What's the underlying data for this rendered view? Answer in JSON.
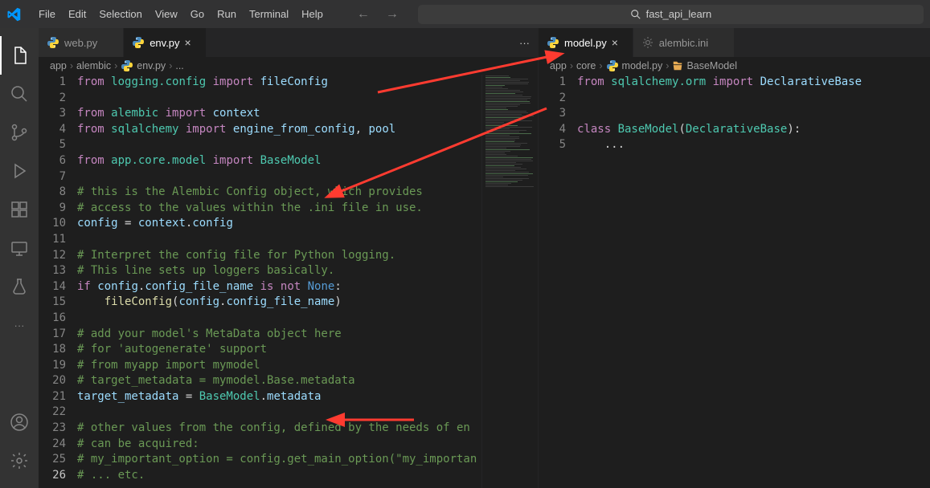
{
  "titlebar": {
    "menus": [
      "File",
      "Edit",
      "Selection",
      "View",
      "Go",
      "Run",
      "Terminal",
      "Help"
    ],
    "search": "fast_api_learn"
  },
  "left": {
    "tabs": [
      {
        "name": "web.py",
        "active": false
      },
      {
        "name": "env.py",
        "active": true
      }
    ],
    "breadcrumb": [
      "app",
      "alembic",
      "env.py",
      "..."
    ],
    "code": [
      {
        "n": 1,
        "t": [
          [
            "from ",
            "kw"
          ],
          [
            "logging.config ",
            "mod"
          ],
          [
            "import ",
            "kw"
          ],
          [
            "fileConfig",
            "var"
          ]
        ]
      },
      {
        "n": 2,
        "t": []
      },
      {
        "n": 3,
        "t": [
          [
            "from ",
            "kw"
          ],
          [
            "alembic ",
            "mod"
          ],
          [
            "import ",
            "kw"
          ],
          [
            "context",
            "var"
          ]
        ]
      },
      {
        "n": 4,
        "t": [
          [
            "from ",
            "kw"
          ],
          [
            "sqlalchemy ",
            "mod"
          ],
          [
            "import ",
            "kw"
          ],
          [
            "engine_from_config",
            "var"
          ],
          [
            ", ",
            "op"
          ],
          [
            "pool",
            "var"
          ]
        ]
      },
      {
        "n": 5,
        "t": []
      },
      {
        "n": 6,
        "t": [
          [
            "from ",
            "kw"
          ],
          [
            "app.core.model ",
            "mod"
          ],
          [
            "import ",
            "kw"
          ],
          [
            "BaseModel",
            "cls"
          ]
        ]
      },
      {
        "n": 7,
        "t": []
      },
      {
        "n": 8,
        "t": [
          [
            "# this is the Alembic Config object, which provides",
            "cmt"
          ]
        ]
      },
      {
        "n": 9,
        "t": [
          [
            "# access to the values within the .ini file in use.",
            "cmt"
          ]
        ]
      },
      {
        "n": 10,
        "t": [
          [
            "config ",
            "var"
          ],
          [
            "= ",
            "op"
          ],
          [
            "context",
            "var"
          ],
          [
            ".",
            "op"
          ],
          [
            "config",
            "var"
          ]
        ]
      },
      {
        "n": 11,
        "t": []
      },
      {
        "n": 12,
        "t": [
          [
            "# Interpret the config file for Python logging.",
            "cmt"
          ]
        ]
      },
      {
        "n": 13,
        "t": [
          [
            "# This line sets up loggers basically.",
            "cmt"
          ]
        ]
      },
      {
        "n": 14,
        "t": [
          [
            "if ",
            "kw"
          ],
          [
            "config",
            "var"
          ],
          [
            ".",
            "op"
          ],
          [
            "config_file_name ",
            "var"
          ],
          [
            "is not ",
            "kw"
          ],
          [
            "None",
            "none"
          ],
          [
            ":",
            ""
          ]
        ]
      },
      {
        "n": 15,
        "t": [
          [
            "    ",
            ""
          ],
          [
            "fileConfig",
            "fn"
          ],
          [
            "(",
            "op"
          ],
          [
            "config",
            "var"
          ],
          [
            ".",
            "op"
          ],
          [
            "config_file_name",
            "var"
          ],
          [
            ")",
            "op"
          ]
        ]
      },
      {
        "n": 16,
        "t": []
      },
      {
        "n": 17,
        "t": [
          [
            "# add your model's MetaData object here",
            "cmt"
          ]
        ]
      },
      {
        "n": 18,
        "t": [
          [
            "# for 'autogenerate' support",
            "cmt"
          ]
        ]
      },
      {
        "n": 19,
        "t": [
          [
            "# from myapp import mymodel",
            "cmt"
          ]
        ]
      },
      {
        "n": 20,
        "t": [
          [
            "# target_metadata = mymodel.Base.metadata",
            "cmt"
          ]
        ]
      },
      {
        "n": 21,
        "t": [
          [
            "target_metadata ",
            "var"
          ],
          [
            "= ",
            "op"
          ],
          [
            "BaseModel",
            "cls"
          ],
          [
            ".",
            "op"
          ],
          [
            "metadata",
            "var"
          ]
        ]
      },
      {
        "n": 22,
        "t": []
      },
      {
        "n": 23,
        "t": [
          [
            "# other values from the config, defined by the needs of en",
            "cmt"
          ]
        ]
      },
      {
        "n": 24,
        "t": [
          [
            "# can be acquired:",
            "cmt"
          ]
        ]
      },
      {
        "n": 25,
        "t": [
          [
            "# my_important_option = config.get_main_option(\"my_importan",
            "cmt"
          ]
        ]
      },
      {
        "n": 26,
        "t": [
          [
            "# ... etc.",
            "cmt"
          ]
        ],
        "current": true
      }
    ]
  },
  "right": {
    "tabs": [
      {
        "name": "model.py",
        "active": true
      },
      {
        "name": "alembic.ini",
        "active": false,
        "gear": true
      }
    ],
    "breadcrumb": [
      "app",
      "core",
      "model.py",
      "BaseModel"
    ],
    "code": [
      {
        "n": 1,
        "t": [
          [
            "from ",
            "kw"
          ],
          [
            "sqlalchemy.orm ",
            "mod"
          ],
          [
            "import ",
            "kw"
          ],
          [
            "DeclarativeBase",
            "var"
          ]
        ]
      },
      {
        "n": 2,
        "t": []
      },
      {
        "n": 3,
        "t": []
      },
      {
        "n": 4,
        "t": [
          [
            "class ",
            "kw"
          ],
          [
            "BaseModel",
            "cls"
          ],
          [
            "(",
            "op"
          ],
          [
            "DeclarativeBase",
            "cls"
          ],
          [
            ")",
            "op"
          ],
          [
            ":",
            ""
          ]
        ]
      },
      {
        "n": 5,
        "t": [
          [
            "    ...",
            ""
          ]
        ]
      }
    ]
  }
}
